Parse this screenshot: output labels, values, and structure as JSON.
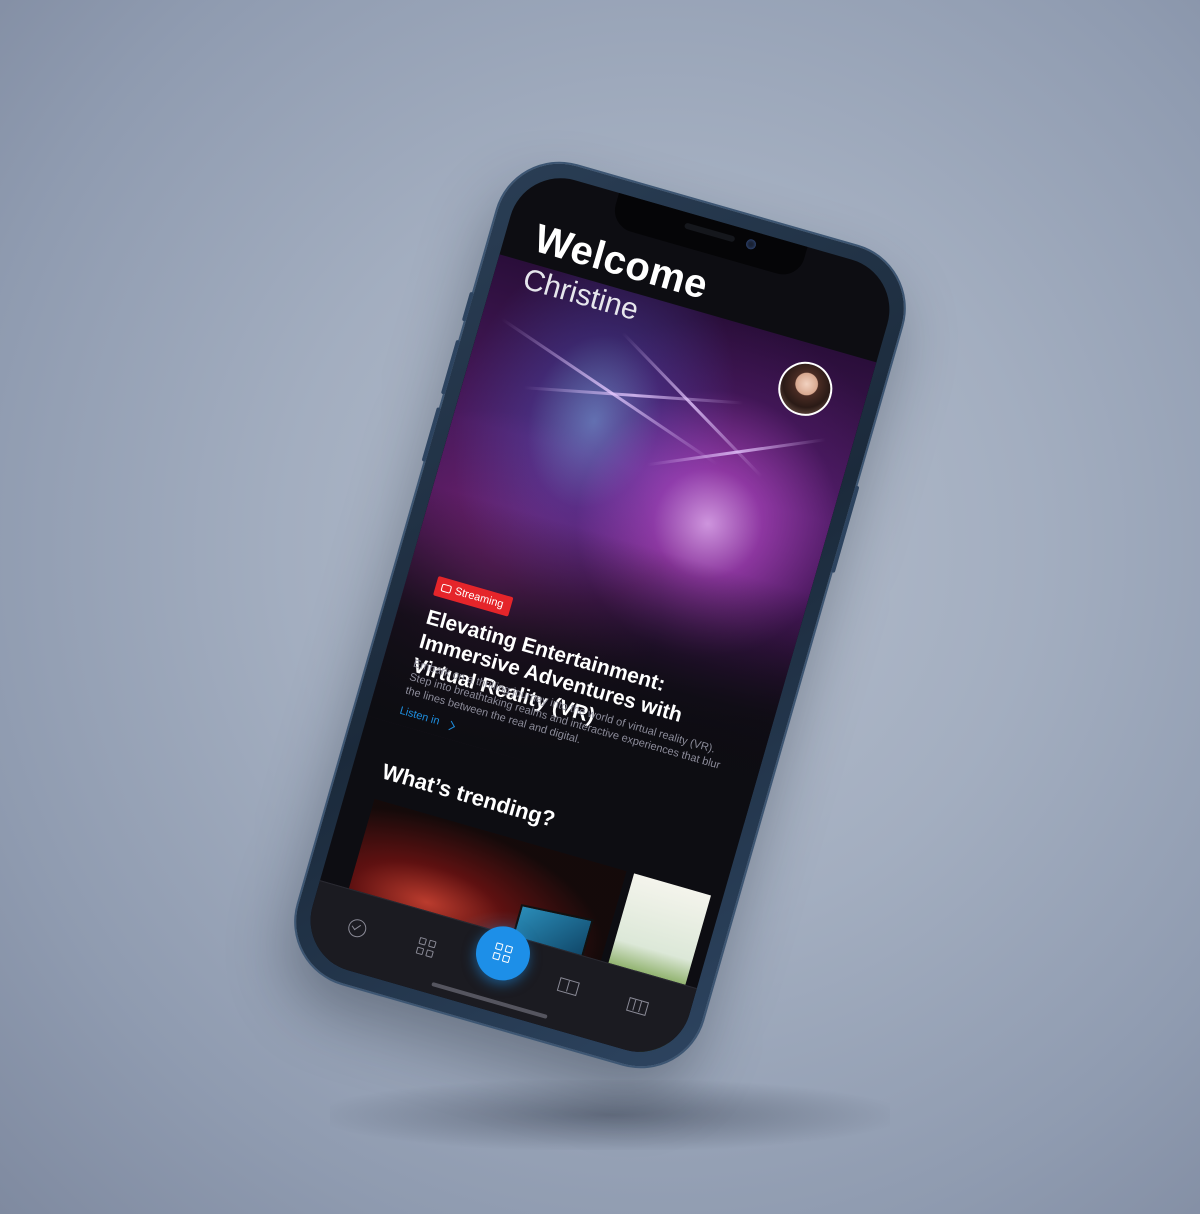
{
  "greeting": {
    "title": "Welcome",
    "name": "Christine"
  },
  "featured": {
    "badge": "Streaming",
    "headline": "Elevating Entertainment: Immersive Adventures with Virtual Reality (VR)",
    "description": "Embark on a thrilling journey into the world of virtual reality (VR). Step into breathtaking realms and interactive experiences that blur the lines between the real and digital.",
    "cta": "Listen in"
  },
  "trending": {
    "title": "What’s trending?"
  },
  "tabbar": {
    "items": [
      {
        "icon": "check-circle-icon"
      },
      {
        "icon": "grid-icon"
      },
      {
        "icon": "grid-icon",
        "active": true
      },
      {
        "icon": "book-info-icon"
      },
      {
        "icon": "map-icon"
      }
    ]
  },
  "colors": {
    "accent": "#1d8fe8",
    "badge": "#e5252a",
    "background": "#0d0d12"
  }
}
